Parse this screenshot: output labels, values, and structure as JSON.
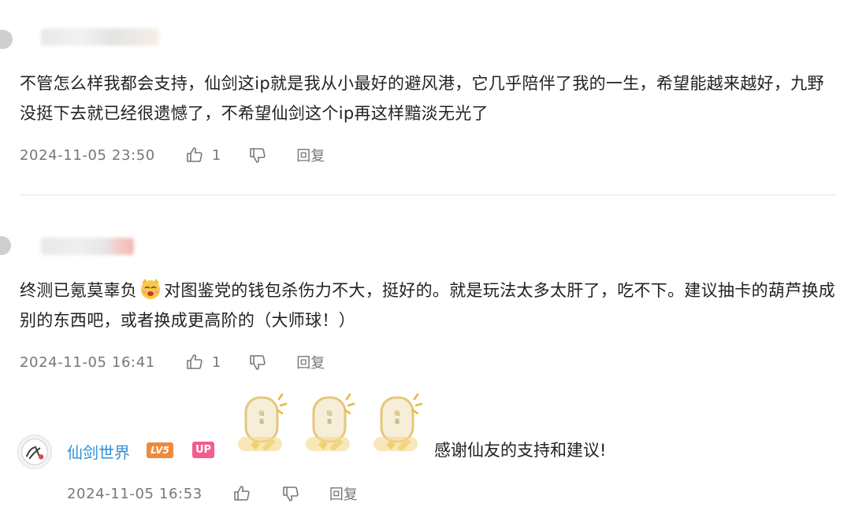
{
  "comments": [
    {
      "text": "不管怎么样我都会支持，仙剑这ip就是我从小最好的避风港，它几乎陪伴了我的一生，希望能越来越好，九野没挺下去就已经很遗憾了，不希望仙剑这个ip再这样黯淡无光了",
      "date": "2024-11-05 23:50",
      "likes": "1",
      "reply_label": "回复"
    },
    {
      "text_before_emoji": "终测已氪莫辜负",
      "text_after_emoji": "对图鉴党的钱包杀伤力不大，挺好的。就是玩法太多太肝了，吃不下。建议抽卡的葫芦换成别的东西吧，或者换成更高阶的（大师球！）",
      "date": "2024-11-05 16:41",
      "likes": "1",
      "reply_label": "回复"
    }
  ],
  "official_reply": {
    "name": "仙剑世界",
    "level_badge": "LV5",
    "up_badge": "UP",
    "text": "感谢仙友的支持和建议!",
    "date": "2024-11-05 16:53",
    "reply_label": "回复"
  },
  "colors": {
    "name_blue": "#2f8fd8",
    "level_orange": "#f08a3a",
    "up_pink": "#f25d8e",
    "meta_gray": "#777777"
  },
  "icons": [
    "thumbs-up-icon",
    "thumbs-down-icon",
    "cat-emoji-icon",
    "sticker-icon"
  ]
}
